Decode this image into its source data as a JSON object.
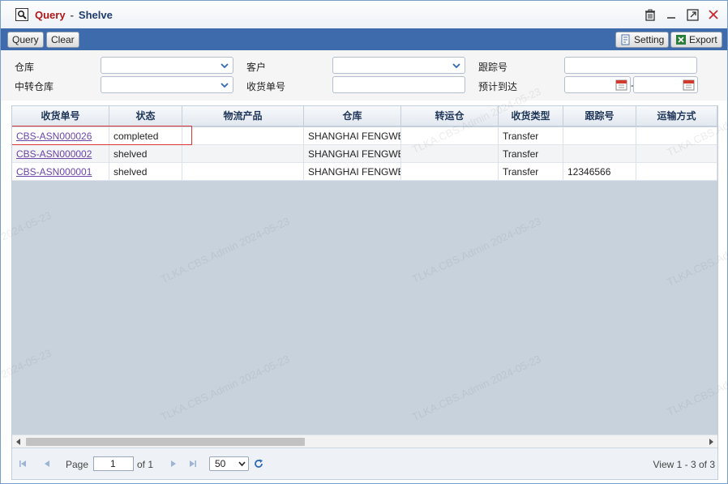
{
  "window": {
    "title": "Query",
    "separator": "-",
    "subtitle": "Shelve"
  },
  "toolbar": {
    "query_label": "Query",
    "clear_label": "Clear",
    "setting_label": "Setting",
    "export_label": "Export"
  },
  "form": {
    "warehouse_label": "仓库",
    "customer_label": "客户",
    "tracking_label": "跟踪号",
    "transit_warehouse_label": "中转仓库",
    "receipt_no_label": "收货单号",
    "eta_label": "预计到达",
    "date_separator": "-"
  },
  "grid": {
    "headers": [
      "收货单号",
      "状态",
      "物流产品",
      "仓库",
      "转运仓",
      "收货类型",
      "跟踪号",
      "运输方式"
    ],
    "rows": [
      {
        "receipt_no": "CBS-ASN000026",
        "status": "completed",
        "product": "",
        "warehouse": "SHANGHAI FENGWE",
        "transit": "",
        "type": "Transfer",
        "tracking": "",
        "shipping": ""
      },
      {
        "receipt_no": "CBS-ASN000002",
        "status": "shelved",
        "product": "",
        "warehouse": "SHANGHAI FENGWE",
        "transit": "",
        "type": "Transfer",
        "tracking": "",
        "shipping": ""
      },
      {
        "receipt_no": "CBS-ASN000001",
        "status": "shelved",
        "product": "",
        "warehouse": "SHANGHAI FENGWE",
        "transit": "",
        "type": "Transfer",
        "tracking": "12346566",
        "shipping": ""
      }
    ]
  },
  "pager": {
    "page_label": "Page",
    "page_value": "1",
    "of_label": "of 1",
    "page_size": "50",
    "view_text": "View 1 - 3 of 3"
  },
  "watermark": {
    "text_a": "TLKA.CBS.Admin 2024-05-23",
    "text_b": "2024-05-23",
    "text_c": "TLKA.CBS.Admi"
  },
  "colors": {
    "title": "#b01818",
    "toolbar": "#3d6bab",
    "link": "#6b45a8",
    "highlight": "#d9363b"
  }
}
